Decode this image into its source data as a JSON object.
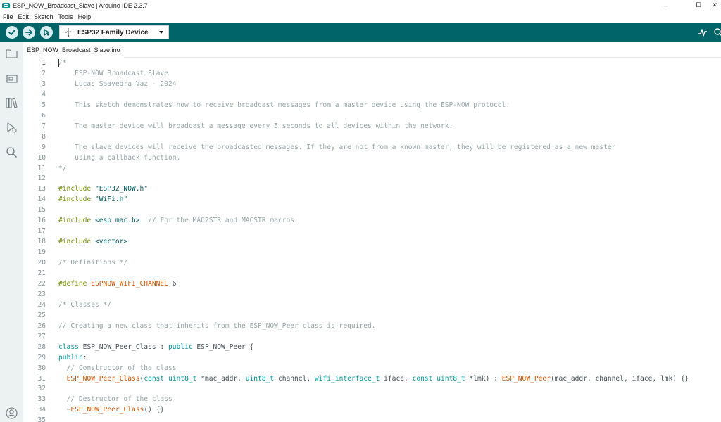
{
  "window": {
    "title": "ESP_NOW_Broadcast_Slave | Arduino IDE 2.3.7",
    "minimize": "–",
    "maximize": "⧠",
    "close": "✕"
  },
  "menu": [
    "File",
    "Edit",
    "Sketch",
    "Tools",
    "Help"
  ],
  "toolbar": {
    "verify_icon": "check-icon",
    "upload_icon": "arrow-right-icon",
    "debug_icon": "debug-icon",
    "board_label": "ESP32 Family Device",
    "serial_plotter_icon": "serial-plotter-icon",
    "serial_monitor_icon": "serial-monitor-icon"
  },
  "sidebar": [
    "folder-icon",
    "board-manager-icon",
    "library-icon",
    "debug-icon",
    "search-icon",
    "account-icon"
  ],
  "tabs": [
    {
      "label": "ESP_NOW_Broadcast_Slave.ino",
      "active": true
    }
  ],
  "editor": {
    "active_line": 1,
    "lines": [
      [
        [
          "cm",
          "/*"
        ]
      ],
      [
        [
          "cm",
          "    ESP-NOW Broadcast Slave"
        ]
      ],
      [
        [
          "cm",
          "    Lucas Saavedra Vaz - 2024"
        ]
      ],
      [
        [
          "cm",
          ""
        ]
      ],
      [
        [
          "cm",
          "    This sketch demonstrates how to receive broadcast messages from a master device using the ESP-NOW protocol."
        ]
      ],
      [
        [
          "cm",
          ""
        ]
      ],
      [
        [
          "cm",
          "    The master device will broadcast a message every 5 seconds to all devices within the network."
        ]
      ],
      [
        [
          "cm",
          ""
        ]
      ],
      [
        [
          "cm",
          "    The slave devices will receive the broadcasted messages. If they are not from a known master, they will be registered as a new master"
        ]
      ],
      [
        [
          "cm",
          "    using a callback function."
        ]
      ],
      [
        [
          "cm",
          "*/"
        ]
      ],
      [],
      [
        [
          "pp",
          "#include "
        ],
        [
          "st",
          "\"ESP32_NOW.h\""
        ]
      ],
      [
        [
          "pp",
          "#include "
        ],
        [
          "st",
          "\"WiFi.h\""
        ]
      ],
      [],
      [
        [
          "pp",
          "#include "
        ],
        [
          "st",
          "<esp_mac.h>"
        ],
        [
          "tx",
          "  "
        ],
        [
          "cm",
          "// For the MAC2STR and MACSTR macros"
        ]
      ],
      [],
      [
        [
          "pp",
          "#include "
        ],
        [
          "st",
          "<vector>"
        ]
      ],
      [],
      [
        [
          "cm",
          "/* Definitions */"
        ]
      ],
      [],
      [
        [
          "pp",
          "#define "
        ],
        [
          "mc",
          "ESPNOW_WIFI_CHANNEL"
        ],
        [
          "tx",
          " 6"
        ]
      ],
      [],
      [
        [
          "cm",
          "/* Classes */"
        ]
      ],
      [],
      [
        [
          "cm",
          "// Creating a new class that inherits from the ESP_NOW_Peer class is required."
        ]
      ],
      [],
      [
        [
          "kw",
          "class"
        ],
        [
          "tx",
          " ESP_NOW_Peer_Class : "
        ],
        [
          "kw",
          "public"
        ],
        [
          "tx",
          " ESP_NOW_Peer {"
        ]
      ],
      [
        [
          "kw",
          "public"
        ],
        [
          "tx",
          ":"
        ]
      ],
      [
        [
          "tx",
          "  "
        ],
        [
          "cm",
          "// Constructor of the class"
        ]
      ],
      [
        [
          "tx",
          "  "
        ],
        [
          "fn",
          "ESP_NOW_Peer_Class"
        ],
        [
          "tx",
          "("
        ],
        [
          "kw",
          "const"
        ],
        [
          "tx",
          " "
        ],
        [
          "ty",
          "uint8_t"
        ],
        [
          "tx",
          " *mac_addr, "
        ],
        [
          "ty",
          "uint8_t"
        ],
        [
          "tx",
          " channel, "
        ],
        [
          "ty",
          "wifi_interface_t"
        ],
        [
          "tx",
          " iface, "
        ],
        [
          "kw",
          "const"
        ],
        [
          "tx",
          " "
        ],
        [
          "ty",
          "uint8_t"
        ],
        [
          "tx",
          " *lmk) : "
        ],
        [
          "fn",
          "ESP_NOW_Peer"
        ],
        [
          "tx",
          "(mac_addr, channel, iface, lmk) {}"
        ]
      ],
      [],
      [
        [
          "tx",
          "  "
        ],
        [
          "cm",
          "// Destructor of the class"
        ]
      ],
      [
        [
          "tx",
          "  "
        ],
        [
          "fn",
          "~ESP_NOW_Peer_Class"
        ],
        [
          "tx",
          "() {}"
        ]
      ],
      []
    ]
  }
}
